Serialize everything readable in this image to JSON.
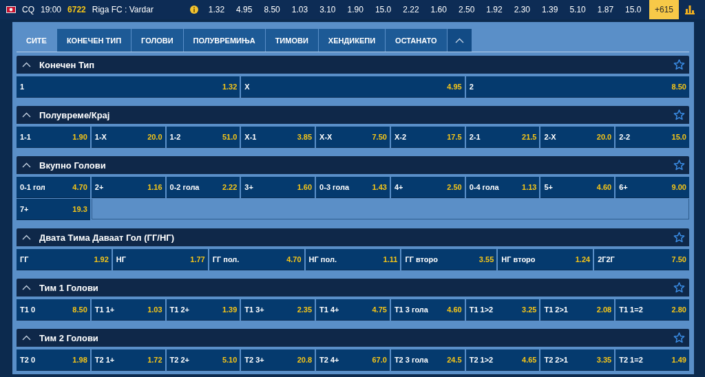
{
  "match": {
    "country": "CQ",
    "time": "19:00",
    "code": "6722",
    "teams": "Riga FC : Vardar"
  },
  "quick_odds": [
    "1.32",
    "4.95",
    "8.50",
    "1.03",
    "3.10",
    "1.90",
    "15.0",
    "2.22",
    "1.60",
    "2.50",
    "1.92",
    "2.30",
    "1.39",
    "5.10",
    "1.87",
    "15.0"
  ],
  "more_markets": "+615",
  "tabs": [
    {
      "label": "СИТЕ",
      "selected": true
    },
    {
      "label": "КОНЕЧЕН ТИП",
      "selected": false
    },
    {
      "label": "ГОЛОВИ",
      "selected": false
    },
    {
      "label": "ПОЛУВРЕМИЊА",
      "selected": false
    },
    {
      "label": "ТИМОВИ",
      "selected": false
    },
    {
      "label": "ХЕНДИКЕПИ",
      "selected": false
    },
    {
      "label": "ОСТАНАТО",
      "selected": false
    }
  ],
  "markets": [
    {
      "title": "Конечен Тип",
      "expanded": true,
      "kind": "triple",
      "outcomes": [
        {
          "label": "1",
          "odds": "1.32"
        },
        {
          "label": "X",
          "odds": "4.95"
        },
        {
          "label": "2",
          "odds": "8.50"
        }
      ]
    },
    {
      "title": "Полувреме/Крај",
      "expanded": true,
      "kind": "ninefold",
      "outcomes": [
        {
          "label": "1-1",
          "odds": "1.90"
        },
        {
          "label": "1-X",
          "odds": "20.0"
        },
        {
          "label": "1-2",
          "odds": "51.0"
        },
        {
          "label": "X-1",
          "odds": "3.85"
        },
        {
          "label": "X-X",
          "odds": "7.50"
        },
        {
          "label": "X-2",
          "odds": "17.5"
        },
        {
          "label": "2-1",
          "odds": "21.5"
        },
        {
          "label": "2-X",
          "odds": "20.0"
        },
        {
          "label": "2-2",
          "odds": "15.0"
        }
      ]
    },
    {
      "title": "Вкупно Голови",
      "expanded": true,
      "kind": "ninefold",
      "outcomes": [
        {
          "label": "0-1 гол",
          "odds": "4.70"
        },
        {
          "label": "2+",
          "odds": "1.16"
        },
        {
          "label": "0-2 гола",
          "odds": "2.22"
        },
        {
          "label": "3+",
          "odds": "1.60"
        },
        {
          "label": "0-3 гола",
          "odds": "1.43"
        },
        {
          "label": "4+",
          "odds": "2.50"
        },
        {
          "label": "0-4 гола",
          "odds": "1.13"
        },
        {
          "label": "5+",
          "odds": "4.60"
        },
        {
          "label": "6+",
          "odds": "9.00"
        },
        {
          "label": "7+",
          "odds": "19.3"
        }
      ]
    },
    {
      "title": "Двата Тима Даваат Гол (ГГ/НГ)",
      "expanded": true,
      "kind": "sevenfold",
      "outcomes": [
        {
          "label": "ГГ",
          "odds": "1.92"
        },
        {
          "label": "НГ",
          "odds": "1.77"
        },
        {
          "label": "ГГ пол.",
          "odds": "4.70"
        },
        {
          "label": "НГ пол.",
          "odds": "1.11"
        },
        {
          "label": "ГГ второ",
          "odds": "3.55"
        },
        {
          "label": "НГ второ",
          "odds": "1.24"
        },
        {
          "label": "2Г2Г",
          "odds": "7.50"
        }
      ]
    },
    {
      "title": "Тим 1 Голови",
      "expanded": true,
      "kind": "ninefold",
      "outcomes": [
        {
          "label": "Т1 0",
          "odds": "8.50"
        },
        {
          "label": "Т1 1+",
          "odds": "1.03"
        },
        {
          "label": "Т1 2+",
          "odds": "1.39"
        },
        {
          "label": "Т1 3+",
          "odds": "2.35"
        },
        {
          "label": "Т1 4+",
          "odds": "4.75"
        },
        {
          "label": "Т1 3 гола",
          "odds": "4.60"
        },
        {
          "label": "Т1 1>2",
          "odds": "3.25"
        },
        {
          "label": "Т1 2>1",
          "odds": "2.08"
        },
        {
          "label": "Т1 1=2",
          "odds": "2.80"
        }
      ]
    },
    {
      "title": "Тим 2 Голови",
      "expanded": true,
      "kind": "ninefold",
      "outcomes": [
        {
          "label": "Т2 0",
          "odds": "1.98"
        },
        {
          "label": "Т2 1+",
          "odds": "1.72"
        },
        {
          "label": "Т2 2+",
          "odds": "5.10"
        },
        {
          "label": "Т2 3+",
          "odds": "20.8"
        },
        {
          "label": "Т2 4+",
          "odds": "67.0"
        },
        {
          "label": "Т2 3 гола",
          "odds": "24.5"
        },
        {
          "label": "Т2 1>2",
          "odds": "4.65"
        },
        {
          "label": "Т2 2>1",
          "odds": "3.35"
        },
        {
          "label": "Т2 1=2",
          "odds": "1.49"
        }
      ]
    }
  ]
}
